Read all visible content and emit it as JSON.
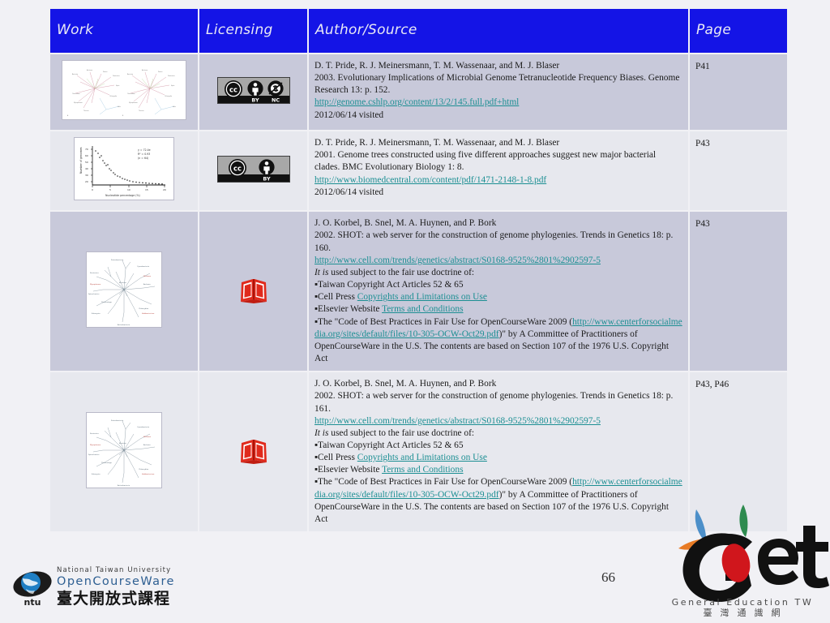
{
  "table": {
    "headers": {
      "work": "Work",
      "licensing": "Licensing",
      "author_source": "Author/Source",
      "page": "Page"
    },
    "rows": [
      {
        "work_thumbnail": "phylogenetic-network-pair-diagram",
        "license": "cc-by-nc-badge",
        "license_label_cc": "CC",
        "license_label_by": "BY",
        "license_label_nc": "NC",
        "authors": "D. T. Pride, R. J. Meinersmann, T. M. Wassenaar, and M. J. Blaser",
        "citation": "2003. Evolutionary Implications of Microbial Genome Tetranucleotide Frequency Biases. Genome Research 13: p. 152.",
        "url": "http://genome.cshlp.org/content/13/2/145.full.pdf+html",
        "visited": "2012/06/14 visited",
        "page": "P41"
      },
      {
        "work_thumbnail": "decay-scatter-plot",
        "license": "cc-by-badge",
        "license_label_cc": "CC",
        "license_label_by": "BY",
        "authors": "D. T. Pride, R. J. Meinersmann, T. M. Wassenaar, and M. J. Blaser",
        "citation": "2001. Genome trees constructed using five different approaches suggest new major bacterial clades. BMC Evolutionary Biology 1: 8.",
        "url": "http://www.biomedcentral.com/content/pdf/1471-2148-1-8.pdf",
        "visited": "2012/06/14 visited",
        "page": "P43"
      },
      {
        "work_thumbnail": "radial-phylogenetic-tree-diagram",
        "license": "red-book-icon",
        "authors": "J. O. Korbel, B. Snel, M. A. Huynen, and P. Bork",
        "citation": "2002. SHOT: a web server for the construction of genome phylogenies. Trends in Genetics 18: p. 160.",
        "url": "http://www.cell.com/trends/genetics/abstract/S0168-9525%2801%2902597-5",
        "fairuse_intro_italic": "It is",
        "fairuse_intro_rest": " used subject to the fair use doctrine of:",
        "bullets": [
          {
            "prefix": "Taiwan Copyright Act Articles 52 & 65",
            "link": "",
            "suffix": ""
          },
          {
            "prefix": "Cell Press ",
            "link": "Copyrights and Limitations on Use",
            "suffix": ""
          },
          {
            "prefix": "Elsevier Website ",
            "link": "Terms and Conditions",
            "suffix": ""
          },
          {
            "prefix": "The \"Code of Best Practices in Fair Use for OpenCourseWare 2009 (",
            "link": "http://www.centerforsocialmedia.org/sites/default/files/10-305-OCW-Oct29.pdf",
            "suffix": ")\" by A Committee of Practitioners of OpenCourseWare in the U.S. The contents are based on Section 107 of the 1976 U.S. Copyright Act"
          }
        ],
        "page": "P43"
      },
      {
        "work_thumbnail": "radial-phylogenetic-tree-diagram",
        "license": "red-book-icon",
        "authors": "J. O. Korbel, B. Snel, M. A. Huynen, and P. Bork",
        "citation": "2002. SHOT: a web server for the construction of genome phylogenies. Trends in Genetics 18: p. 161.",
        "url": "http://www.cell.com/trends/genetics/abstract/S0168-9525%2801%2902597-5",
        "fairuse_intro_italic": "It is",
        "fairuse_intro_rest": " used subject to the fair use doctrine of:",
        "bullets": [
          {
            "prefix": "Taiwan Copyright Act Articles 52 & 65",
            "link": "",
            "suffix": ""
          },
          {
            "prefix": "Cell Press ",
            "link": "Copyrights and Limitations on Use",
            "suffix": ""
          },
          {
            "prefix": "Elsevier Website ",
            "link": "Terms and Conditions",
            "suffix": ""
          },
          {
            "prefix": "The \"Code of Best Practices in Fair Use for OpenCourseWare 2009 (",
            "link": "http://www.centerforsocialmedia.org/sites/default/files/10-305-OCW-Oct29.pdf",
            "suffix": ")\" by A Committee of Practitioners of OpenCourseWare in the U.S. The contents are based on Section 107 of the 1976 U.S. Copyright Act"
          }
        ],
        "page": "P43, P46"
      }
    ]
  },
  "footer": {
    "page_number": "66",
    "ntu": {
      "line1": "National Taiwan University",
      "line2": "OpenCourseWare",
      "line3": "臺大開放式課程",
      "mark": "ntu"
    },
    "get": {
      "wordmark": "Get",
      "subtitle_en": "General Education TW",
      "subtitle_zh": "臺灣通識網"
    }
  },
  "colors": {
    "header_blue": "#1414e6",
    "row_dark": "#c8c9da",
    "row_light": "#e7e8ee",
    "link_teal": "#1c8f93",
    "page_background": "#f1f1f5"
  }
}
